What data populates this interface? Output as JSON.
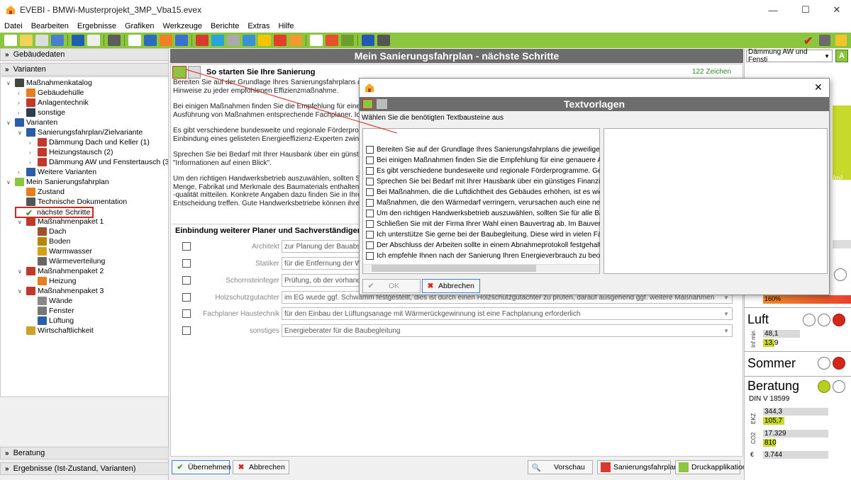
{
  "window": {
    "title": "EVEBI - BMWi-Musterprojekt_3MP_Vba15.evex"
  },
  "menu": [
    "Datei",
    "Bearbeiten",
    "Ergebnisse",
    "Grafiken",
    "Werkzeuge",
    "Berichte",
    "Extras",
    "Hilfe"
  ],
  "left": {
    "sections": {
      "gebaeudedaten": "Gebäudedaten",
      "varianten": "Varianten",
      "beratung": "Beratung",
      "ergebnisse": "Ergebnisse (Ist-Zustand, Varianten)"
    },
    "tree": [
      {
        "label": "Maßnahmenkatalog",
        "level": 0,
        "exp": "v",
        "icon": "catalog-icon"
      },
      {
        "label": "Gebäudehülle",
        "level": 1,
        "exp": ">",
        "icon": "house-icon"
      },
      {
        "label": "Anlagentechnik",
        "level": 1,
        "exp": ">",
        "icon": "plant-icon"
      },
      {
        "label": "sonstige",
        "level": 1,
        "exp": ">",
        "icon": "misc-icon"
      },
      {
        "label": "Varianten",
        "level": 0,
        "exp": "v",
        "icon": "table-icon"
      },
      {
        "label": "Sanierungsfahrplan/Zielvariante",
        "level": 1,
        "exp": "v",
        "icon": "table-icon"
      },
      {
        "label": "Dämmung Dach und Keller (1)",
        "level": 2,
        "exp": ">",
        "icon": "package-icon"
      },
      {
        "label": "Heizungstausch (2)",
        "level": 2,
        "exp": ">",
        "icon": "package-icon"
      },
      {
        "label": "Dämmung AW und Fenstertausch (3)",
        "level": 2,
        "exp": ">",
        "icon": "package-icon"
      },
      {
        "label": "Weitere Varianten",
        "level": 1,
        "exp": ">",
        "icon": "table-icon"
      },
      {
        "label": "Mein Sanierungsfahrplan",
        "level": 0,
        "exp": "v",
        "icon": "roadmap-icon"
      },
      {
        "label": "Zustand",
        "level": 1,
        "exp": "",
        "icon": "house-icon"
      },
      {
        "label": "Technische Dokumentation",
        "level": 1,
        "exp": "",
        "icon": "doc-icon"
      },
      {
        "label": "nächste Schritte",
        "level": 1,
        "exp": "",
        "icon": "check-icon",
        "selected": true
      },
      {
        "label": "Maßnahmenpaket 1",
        "level": 1,
        "exp": "v",
        "icon": "package-icon"
      },
      {
        "label": "Dach",
        "level": 2,
        "exp": "",
        "icon": "roof-icon"
      },
      {
        "label": "Boden",
        "level": 2,
        "exp": "",
        "icon": "floor-icon"
      },
      {
        "label": "Warmwasser",
        "level": 2,
        "exp": "",
        "icon": "water-icon"
      },
      {
        "label": "Wärmeverteilung",
        "level": 2,
        "exp": "",
        "icon": "radiator-icon"
      },
      {
        "label": "Maßnahmenpaket 2",
        "level": 1,
        "exp": "v",
        "icon": "package-icon"
      },
      {
        "label": "Heizung",
        "level": 2,
        "exp": "",
        "icon": "flame-icon"
      },
      {
        "label": "Maßnahmenpaket 3",
        "level": 1,
        "exp": "v",
        "icon": "package-icon"
      },
      {
        "label": "Wände",
        "level": 2,
        "exp": "",
        "icon": "wall-icon"
      },
      {
        "label": "Fenster",
        "level": 2,
        "exp": "",
        "icon": "window-icon"
      },
      {
        "label": "Lüftung",
        "level": 2,
        "exp": "",
        "icon": "fan-icon"
      },
      {
        "label": "Wirtschaftlichkeit",
        "level": 1,
        "exp": "",
        "icon": "coins-icon"
      }
    ]
  },
  "center": {
    "title": "Mein Sanierungsfahrplan - nächste Schritte",
    "section1_title": "So starten Sie Ihre Sanierung",
    "char_count": "122 Zeichen",
    "hint": [
      "Bereiten Sie auf der Grundlage Ihres Sanierungsfahrplans die je\nHinweise zu jeder empfohlenen Effizienzmaßnahme.",
      "Bei einigen Maßnahmen finden Sie die Empfehlung für eine gen\nAusführung von Maßnahmen entsprechende Fachplaner. Ich b",
      "Es gibt verschiedene bundesweite und regionale Förderprogra\nEinbindung eines gelisteten Energieeffizienz-Experten zwingen",
      "Sprechen Sie bei Bedarf mit Ihrer Hausbank über ein günstiges\n\"Informationen auf einen Blick\".",
      "Um den richtigen Handwerksbetrieb auszuwählen, sollten Sie fü\nMenge, Fabrikat und Merkmale des Baumaterials enthalten. Da\n-qualität mitteilen. Konkrete Angaben dazu finden Sie in Ihrer U\nEntscheidung treffen. Gute Handwerksbetriebe können ihre Kno"
    ],
    "section2_title": "Einbindung weiterer Planer und Sachverständiger",
    "planners": [
      {
        "label": "Architekt",
        "value": "zur Planung der Bauabschnitte"
      },
      {
        "label": "Statiker",
        "value": "für die Entfernung der Wand in"
      },
      {
        "label": "Schornsteinfeger",
        "value": "Prüfung, ob der vorhandene S"
      },
      {
        "label": "Holzschutzgutachter",
        "value": "im EG wurde ggf. Schwamm festgestellt, dies ist durch einen Holzschutzgutachter zu prüfen, darauf ausgehend ggf. weitere Maßnahmen"
      },
      {
        "label": "Fachplaner Haustechnik",
        "value": "für den Einbau der Lüftungsanage mit Wärmerückgewinnung ist eine Fachplanung erforderlich"
      },
      {
        "label": "sonstiges",
        "value": "Energieberater für die Baubegleitung"
      }
    ],
    "buttons": {
      "apply": "Übernehmen",
      "cancel": "Abbrechen",
      "preview": "Vorschau",
      "roadmap": "Sanierungsfahrplan",
      "print": "Druckapplikation"
    }
  },
  "right": {
    "dropdown": "Dämmung AW und Fensti",
    "unit_fragment": "/m²",
    "pct": "160%",
    "luft": "Luft",
    "luft_label": "Inf min",
    "luft_v1": "48,1",
    "luft_v2": "13,9",
    "sommer": "Sommer",
    "beratung": "Beratung",
    "din": "DIN V 18599",
    "ekz_label": "EKZ",
    "ekz_v1": "344,3",
    "ekz_v2": "105,7",
    "co2_label": "CO2",
    "co2_v1": "17.329",
    "co2_v2": "810",
    "euro_v": "3.744"
  },
  "dialog": {
    "title": "Textvorlagen",
    "subtitle": "Wählen Sie die benötigten Textbausteine aus",
    "items": [
      "Bereiten Sie auf der Grundlage Ihres Sanierungsfahrplans die jeweiligen Sa",
      "Bei einigen Maßnahmen finden Sie die Empfehlung für eine genauere Analys",
      "Es gibt verschiedene bundesweite und regionale Förderprogramme. Gerne",
      "Sprechen Sie bei Bedarf mit Ihrer Hausbank über ein günstiges Finanzierung",
      "Bei Maßnahmen, die die Luftdichtheit des Gebäudes erhöhen, ist es wichtig",
      "Maßnahmen, die den Wärmedarf verringern, verursachen auch eine neue W",
      "Um den richtigen Handwerksbetrieb auszuwählen, sollten Sie für alle Bauleis",
      "Schließen Sie mit der Firma Ihrer Wahl einen Bauvertrag ab. Im Bauvertrag",
      "Ich unterstütze Sie gerne bei der Baubegleitung. Diese wird in vielen Fällen",
      "Der Abschluss der Arbeiten sollte in einem Abnahmeprotokoll festgehalten v",
      "Ich empfehle Ihnen nach der Sanierung Ihren Energieverbrauch zu beobac"
    ],
    "ok": "OK",
    "cancel": "Abbrechen"
  }
}
